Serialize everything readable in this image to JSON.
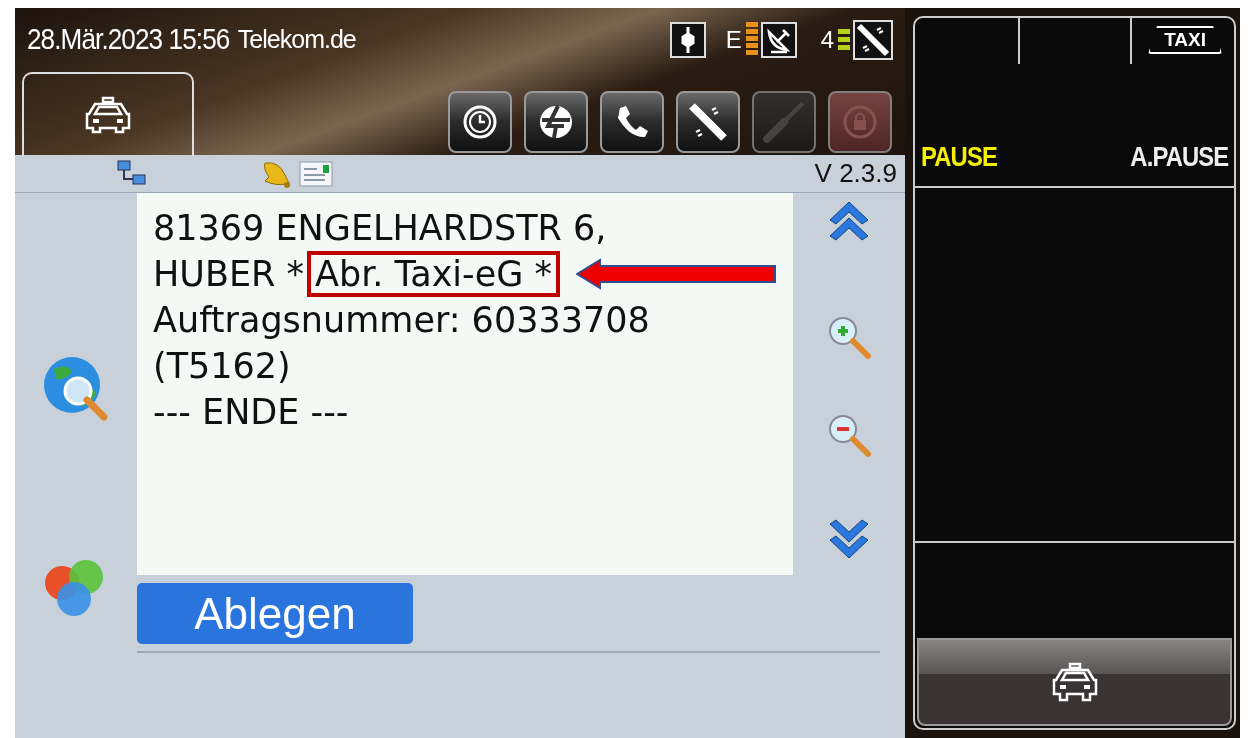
{
  "status_bar": {
    "datetime": "28.Mär.2023 15:56",
    "provider": "Telekom.de",
    "network_label": "E",
    "satellite_count": "4"
  },
  "top_tab": {
    "selected": true
  },
  "toolbar": [
    {
      "kind": "timer",
      "disabled": false
    },
    {
      "kind": "logo",
      "disabled": false
    },
    {
      "kind": "phone",
      "disabled": false
    },
    {
      "kind": "satellite",
      "disabled": false
    },
    {
      "kind": "tool",
      "disabled": true
    },
    {
      "kind": "lock",
      "disabled": true
    }
  ],
  "info_bar": {
    "version": "V 2.3.9"
  },
  "message": {
    "lines": [
      {
        "text": "81369 ENGELHARDSTR 6,"
      },
      {
        "text": "HUBER *",
        "boxed": "Abr. Taxi-eG *"
      },
      {
        "text": "Auftragsnummer: 60333708"
      },
      {
        "text": "(T5162)"
      },
      {
        "text": "--- ENDE ---"
      }
    ]
  },
  "action_button": "Ablegen",
  "taxi_sign": "TAXI",
  "modes": [
    {
      "label": "PAUSE",
      "selected": true
    },
    {
      "label": "A.PAUSE",
      "selected": false
    }
  ]
}
